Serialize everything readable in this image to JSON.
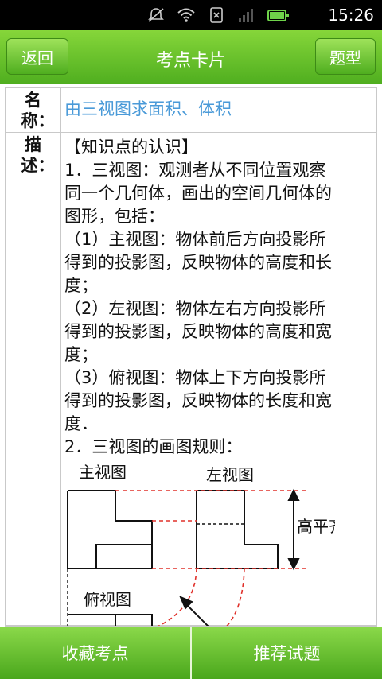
{
  "status_bar": {
    "time": "15:26",
    "icons": [
      "mute-icon",
      "wifi-icon",
      "sim-icon",
      "signal-icon",
      "battery-icon"
    ],
    "battery_color": "#6fd34a"
  },
  "header": {
    "back_label": "返回",
    "title": "考点卡片",
    "type_label": "题型",
    "bar_color": "#5bbd25"
  },
  "card": {
    "name_label": "名称：",
    "name_value": "由三视图求面积、体积",
    "desc_label": "描述：",
    "desc_lines": [
      "【知识点的认识】",
      "1．三视图：观测者从不同位置观察",
      "同一个几何体，画出的空间几何体的",
      "图形，包括：",
      "（1）主视图：物体前后方向投影所",
      "得到的投影图，反映物体的高度和长",
      "度；",
      "（2）左视图：物体左右方向投影所",
      "得到的投影图，反映物体的高度和宽",
      "度；",
      "（3）俯视图：物体上下方向投影所",
      "得到的投影图，反映物体的长度和宽",
      "度．",
      "2．三视图的画图规则："
    ],
    "figure": {
      "front_view_label": "主视图",
      "left_view_label": "左视图",
      "top_view_label": "俯视图",
      "height_rule_label": "高平齐"
    }
  },
  "bottom_bar": {
    "favorite_label": "收藏考点",
    "recommend_label": "推荐试题"
  }
}
